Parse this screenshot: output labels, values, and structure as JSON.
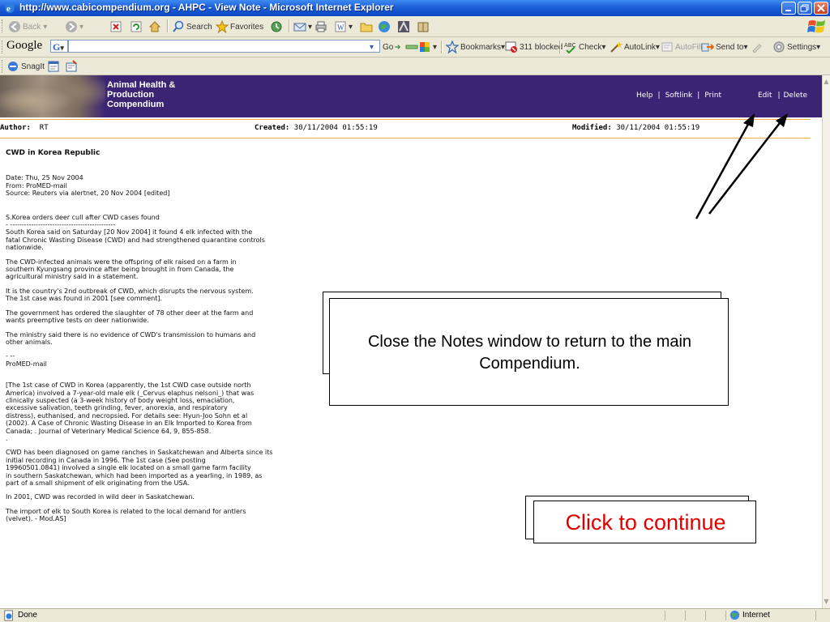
{
  "window": {
    "title": "http://www.cabicompendium.org - AHPC - View Note - Microsoft Internet Explorer"
  },
  "toolbar": {
    "back_label": "Back",
    "search_label": "Search",
    "favorites_label": "Favorites"
  },
  "google_bar": {
    "logo": "Google",
    "g_label": "G",
    "go_label": "Go",
    "bookmarks_label": "Bookmarks",
    "blocked_label": "311 blocked",
    "check_label": "Check",
    "autolink_label": "AutoLink",
    "autofill_label": "AutoFill",
    "sendto_label": "Send to",
    "settings_label": "Settings"
  },
  "snagit_bar": {
    "snagit_label": "SnagIt"
  },
  "site": {
    "name_line1": "Animal Health &",
    "name_line2": "Production",
    "name_line3": "Compendium",
    "nav": {
      "help": "Help",
      "softlink": "Softlink",
      "print": "Print",
      "edit": "Edit",
      "delete": "Delete"
    }
  },
  "meta": {
    "author_label": "Author:",
    "author_value": "RT",
    "created_label": "Created:",
    "created_value": "30/11/2004 01:55:19",
    "modified_label": "Modified:",
    "modified_value": "30/11/2004 01:55:19"
  },
  "article": {
    "heading": "CWD in Korea Republic",
    "paragraphs": [
      "Date: Thu, 25 Nov 2004\nFrom: ProMED-mail\nSource: Reuters via alertnet, 20 Nov 2004 [edited]",
      "",
      "S.Korea orders deer cull after CWD cases found\n- ---------------------------------------------",
      "South Korea said on Saturday [20 Nov 2004] it found 4 elk infected with the\nfatal Chronic Wasting Disease (CWD) and had strengthened quarantine controls\nnationwide.",
      "The CWD-infected animals were the offspring of elk raised on a farm in\nsouthern Kyungsang province after being brought in from Canada, the\nagricultural ministry said in a statement.",
      "It is the country's 2nd outbreak of CWD, which disrupts the nervous system.\nThe 1st case was found in 2001 [see comment].",
      "The government has ordered the slaughter of 78 other deer at the farm and\nwants preemptive tests on deer nationwide.",
      "The ministry said there is no evidence of CWD's transmission to humans and\nother animals.",
      "- --\nProMED-mail",
      "[The 1st case of CWD in Korea (apparently, the 1st CWD case outside north\nAmerica) involved a 7-year-old male elk (_Cervus elaphus nelsoni_) that was\nclinically suspected (a 3-week history of body weight loss, emaciation,\nexcessive salivation, teeth grinding, fever, anorexia, and respiratory\ndistress), euthanised, and necropsied. For details see: Hyun-Joo Sohn et al\n(2002). A Case of Chronic Wasting Disease in an Elk Imported to Korea from\nCanada; . Journal of Veterinary Medical Science 64, 9, 855-858.\n.",
      "CWD has been diagnosed on game ranches in Saskatchewan and Alberta since its\ninitial recording in Canada in 1996. The 1st case (See posting\n19960501.0841) involved a single elk located on a small game farm facility\nin southern Saskatchewan, which had been imported as a yearling, in 1989, as\npart of a small shipment of elk originating from the USA.",
      "In 2001, CWD was recorded in wild deer in Saskatchewan.",
      "The import of elk to South Korea is related to the local demand for antlers\n(velvet). - Mod.AS]"
    ]
  },
  "callouts": {
    "instruction": "Close the Notes window to return to the main Compendium.",
    "continue": "Click to continue"
  },
  "colors": {
    "banner": "#3b2474",
    "continue_text": "#e00000",
    "divider": "#f0b050"
  },
  "status": {
    "left": "Done",
    "zone": "Internet"
  }
}
